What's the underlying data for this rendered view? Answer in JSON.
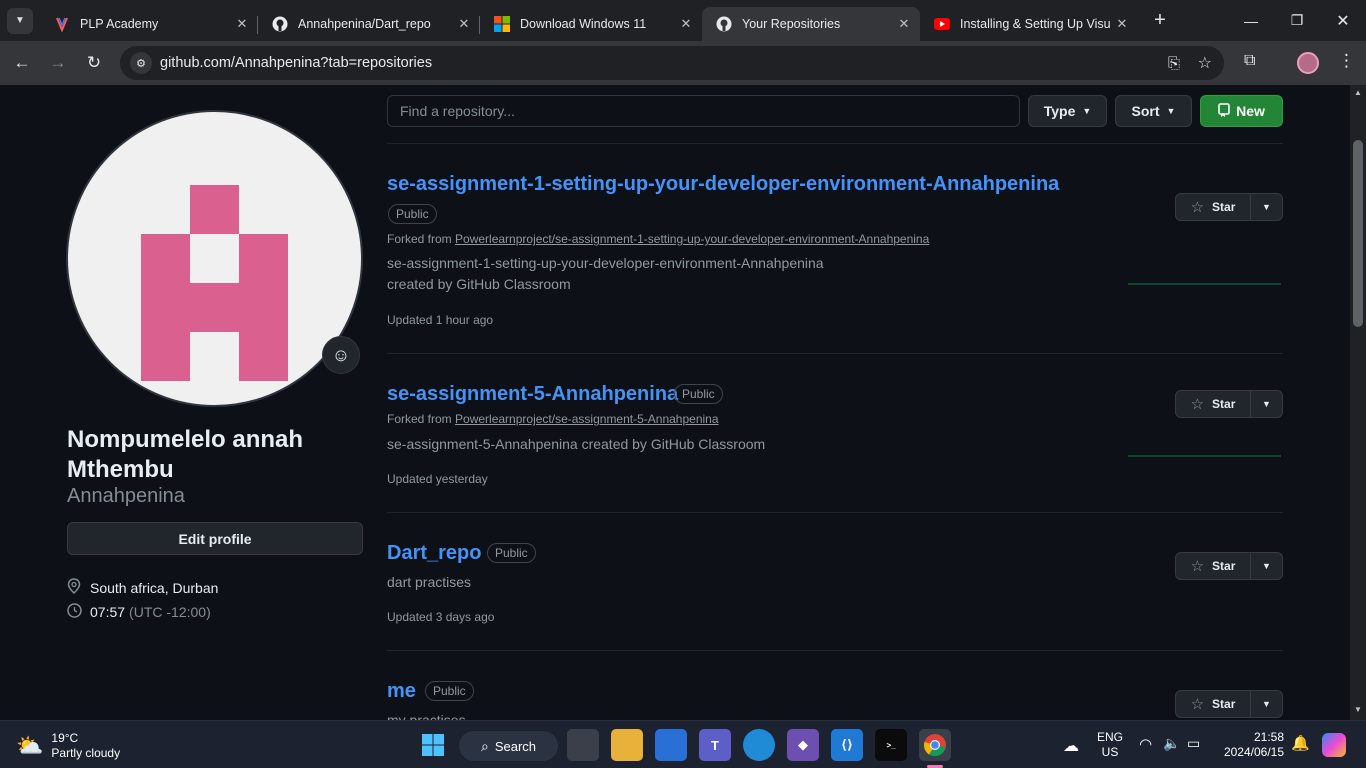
{
  "browser": {
    "tabs": [
      {
        "title": "PLP Academy",
        "icon": "plp-icon",
        "active": false
      },
      {
        "title": "Annahpenina/Dart_repo",
        "icon": "github-icon",
        "active": false
      },
      {
        "title": "Download Windows 11",
        "icon": "windows-icon",
        "active": false
      },
      {
        "title": "Your Repositories",
        "icon": "github-icon",
        "active": true
      },
      {
        "title": "Installing & Setting Up Visu",
        "icon": "youtube-icon",
        "active": false
      }
    ],
    "url": "github.com/Annahpenina?tab=repositories"
  },
  "profile": {
    "full_name": "Nompumelelo annah Mthembu",
    "login": "Annahpenina",
    "edit_label": "Edit profile",
    "location": "South africa, Durban",
    "time": "07:57",
    "timezone": "(UTC -12:00)",
    "avatar_color": "#d9608f"
  },
  "repo_toolbar": {
    "search_placeholder": "Find a repository...",
    "type_label": "Type",
    "sort_label": "Sort",
    "new_label": "New"
  },
  "repos": [
    {
      "name": "se-assignment-1-setting-up-your-developer-environment-Annahpenina",
      "visibility": "Public",
      "forked_prefix": "Forked from",
      "forked_from": "Powerlearnproject/se-assignment-1-setting-up-your-developer-environment-Annahpenina",
      "description": "se-assignment-1-setting-up-your-developer-environment-Annahpenina created by GitHub Classroom",
      "updated": "Updated 1 hour ago",
      "star_label": "Star"
    },
    {
      "name": "se-assignment-5-Annahpenina",
      "visibility": "Public",
      "forked_prefix": "Forked from",
      "forked_from": "Powerlearnproject/se-assignment-5-Annahpenina",
      "description": "se-assignment-5-Annahpenina created by GitHub Classroom",
      "updated": "Updated yesterday",
      "star_label": "Star"
    },
    {
      "name": "Dart_repo",
      "visibility": "Public",
      "description": "dart practises",
      "updated": "Updated 3 days ago",
      "star_label": "Star"
    },
    {
      "name": "me",
      "visibility": "Public",
      "description": "my practises",
      "star_label": "Star"
    }
  ],
  "taskbar": {
    "weather_temp": "19°C",
    "weather_desc": "Partly cloudy",
    "search_label": "Search",
    "lang_line1": "ENG",
    "lang_line2": "US",
    "clock_time": "21:58",
    "clock_date": "2024/06/15"
  },
  "colors": {
    "accent_link": "#4493f8",
    "new_button": "#238636",
    "page_bg": "#0d1117"
  }
}
